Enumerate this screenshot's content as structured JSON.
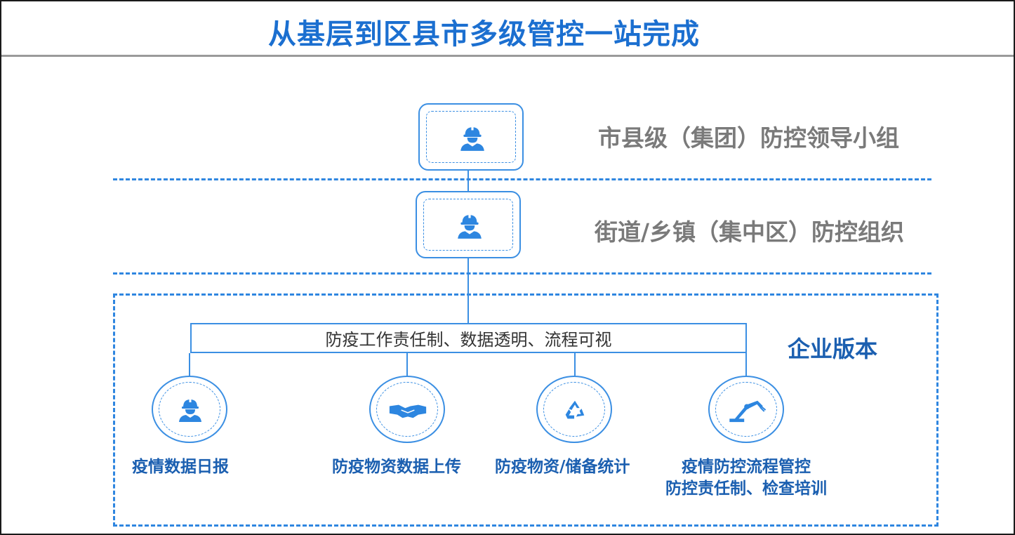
{
  "title": "从基层到区县市多级管控一站完成",
  "levels": [
    {
      "label": "市县级（集团）防控领导小组",
      "icon": "worker-icon"
    },
    {
      "label": "街道/乡镇（集中区）防控组织",
      "icon": "worker-icon"
    }
  ],
  "enterprise": {
    "label": "企业版本",
    "banner": "防疫工作责任制、数据透明、流程可视",
    "features": [
      {
        "lines": [
          "疫情数据日报"
        ],
        "icon": "worker-icon"
      },
      {
        "lines": [
          "防疫物资数据上传"
        ],
        "icon": "handshake-icon"
      },
      {
        "lines": [
          "防疫物资/储备统计"
        ],
        "icon": "recycle-icon"
      },
      {
        "lines": [
          "疫情防控流程管控",
          "防控责任制、检查培训"
        ],
        "icon": "robot-arm-icon"
      }
    ]
  },
  "colors": {
    "title": "#1b6fd0",
    "accent": "#3b8fe3",
    "label_grey": "#7a7a7a",
    "feature_text": "#1b5fb0"
  }
}
